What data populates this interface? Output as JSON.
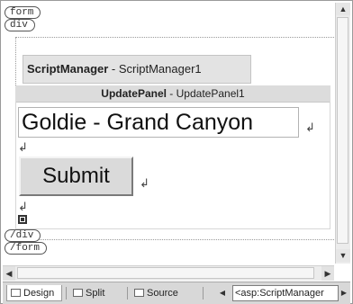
{
  "designer": {
    "tags": {
      "form_open": "form",
      "div_open": "div",
      "div_close": "/div",
      "form_close": "/form"
    },
    "script_manager": {
      "type": "ScriptManager",
      "separator": " - ",
      "id": "ScriptManager1"
    },
    "update_panel": {
      "type": "UpdatePanel",
      "separator": " - ",
      "id": "UpdatePanel1"
    },
    "textbox_value": "Goldie - Grand Canyon",
    "submit_label": "Submit",
    "line_break_glyph": "↲"
  },
  "view_tabs": [
    {
      "label": "Design",
      "active": true,
      "icon": "design-view-icon"
    },
    {
      "label": "Split",
      "active": false,
      "icon": "split-view-icon"
    },
    {
      "label": "Source",
      "active": false,
      "icon": "source-view-icon"
    }
  ],
  "tag_navigator": {
    "current": "<asp:ScriptManager"
  },
  "colors": {
    "surface": "#ffffff",
    "tabbar": "#d8d8d8",
    "smartbox": "#e3e3e3",
    "button_face": "#dadada"
  }
}
